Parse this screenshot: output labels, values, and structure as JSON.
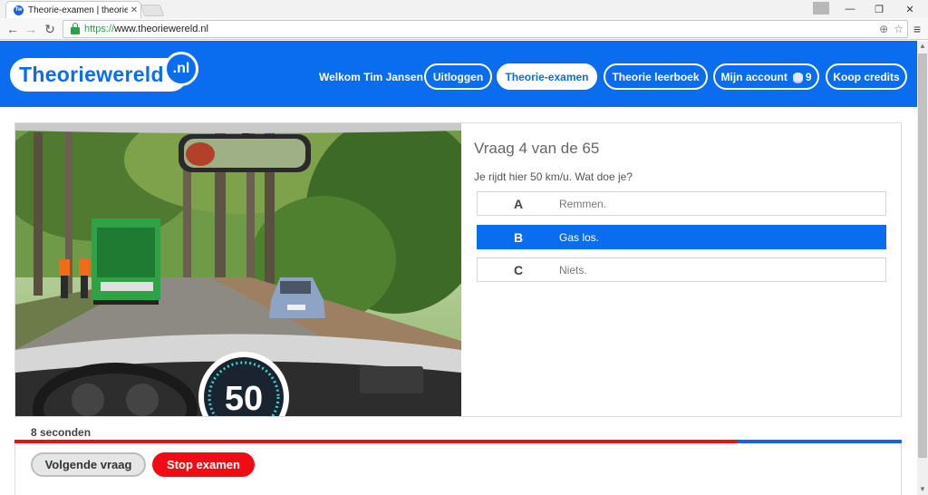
{
  "browser": {
    "tab_title": "Theorie-examen | theorie",
    "tab_favicon": "Tw",
    "url_scheme": "https://",
    "url_rest": "www.theoriewereld.nl"
  },
  "header": {
    "logo_text": "Theoriewereld",
    "logo_suffix": ".nl",
    "welcome": "Welkom Tim Jansen",
    "logout": "Uitloggen",
    "exam": "Theorie-examen",
    "book": "Theorie leerboek",
    "account": "Mijn account",
    "credits_count": "9",
    "buy_credits": "Koop credits"
  },
  "question": {
    "title": "Vraag 4 van de 65",
    "prompt": "Je rijdt hier 50 km/u. Wat doe je?",
    "speed": "50",
    "answers": [
      {
        "letter": "A",
        "text": "Remmen."
      },
      {
        "letter": "B",
        "text": "Gas los."
      },
      {
        "letter": "C",
        "text": "Niets."
      }
    ],
    "selected": "B"
  },
  "timer": {
    "label": "8 seconden",
    "elapsed_fraction": 0.815
  },
  "actions": {
    "next": "Volgende vraag",
    "stop": "Stop examen"
  },
  "colors": {
    "brand": "#0a6df0",
    "stop": "#f20a14",
    "timer_elapsed": "#e0141d"
  }
}
